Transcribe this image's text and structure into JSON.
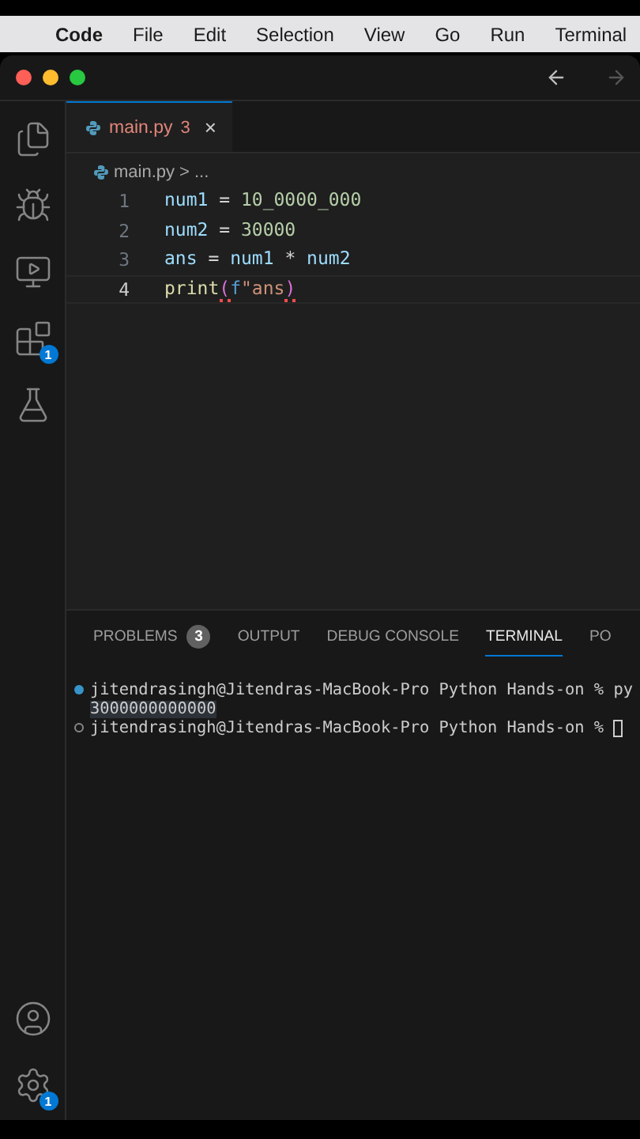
{
  "menu_bar": {
    "app": "Code",
    "items": [
      "File",
      "Edit",
      "Selection",
      "View",
      "Go",
      "Run",
      "Terminal"
    ]
  },
  "activity_bar": {
    "top": [
      {
        "kind": "files"
      },
      {
        "kind": "debug"
      },
      {
        "kind": "remote"
      },
      {
        "kind": "extensions",
        "badge": "1"
      },
      {
        "kind": "testing"
      }
    ],
    "bottom": [
      {
        "kind": "account"
      },
      {
        "kind": "settings",
        "badge": "1"
      }
    ]
  },
  "editor_tabs": [
    {
      "label": "main.py",
      "problems": "3",
      "close": "×",
      "selected": true
    }
  ],
  "breadcrumb": {
    "file": "main.py",
    "separator": ">",
    "rest": "..."
  },
  "code_lines": [
    {
      "number": "1",
      "current": false,
      "tokens": [
        {
          "kind": "var",
          "text": "num1"
        },
        {
          "kind": "op",
          "text": " = "
        },
        {
          "kind": "num",
          "text": "10_0000_000"
        }
      ]
    },
    {
      "number": "2",
      "current": false,
      "tokens": [
        {
          "kind": "var",
          "text": "num2"
        },
        {
          "kind": "op",
          "text": " = "
        },
        {
          "kind": "num",
          "text": "30000"
        }
      ]
    },
    {
      "number": "3",
      "current": false,
      "tokens": [
        {
          "kind": "var",
          "text": "ans"
        },
        {
          "kind": "op",
          "text": " = "
        },
        {
          "kind": "var",
          "text": "num1"
        },
        {
          "kind": "op",
          "text": " * "
        },
        {
          "kind": "var",
          "text": "num2"
        }
      ]
    },
    {
      "number": "4",
      "current": true,
      "tokens": [
        {
          "kind": "fn",
          "text": "print"
        },
        {
          "kind": "paren",
          "text": "(",
          "error": true
        },
        {
          "kind": "kw",
          "text": "f"
        },
        {
          "kind": "str",
          "text": "\"ans"
        },
        {
          "kind": "paren",
          "text": ")",
          "error": true
        }
      ]
    }
  ],
  "panel_tabs": [
    {
      "label": "PROBLEMS",
      "badge": "3",
      "selected": false
    },
    {
      "label": "OUTPUT",
      "selected": false
    },
    {
      "label": "DEBUG CONSOLE",
      "selected": false
    },
    {
      "label": "TERMINAL",
      "selected": true
    },
    {
      "label": "PO",
      "selected": false
    }
  ],
  "terminal_lines": [
    {
      "kind": "prompt",
      "finished": true,
      "text": "jitendrasingh@Jitendras-MacBook-Pro Python Hands-on % py",
      "cursor": false
    },
    {
      "kind": "output",
      "text": "3000000000000"
    },
    {
      "kind": "prompt",
      "finished": false,
      "text": "jitendrasingh@Jitendras-MacBook-Pro Python Hands-on % ",
      "cursor": true
    }
  ]
}
